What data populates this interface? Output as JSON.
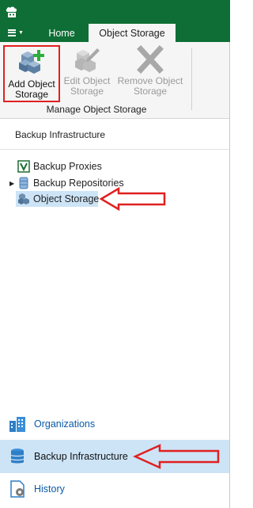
{
  "menu": {
    "home_tab": "Home",
    "active_tab": "Object Storage"
  },
  "ribbon": {
    "add": {
      "line1": "Add Object",
      "line2": "Storage"
    },
    "edit": {
      "line1": "Edit Object",
      "line2": "Storage"
    },
    "remove": {
      "line1": "Remove Object",
      "line2": "Storage"
    },
    "group_label": "Manage Object Storage"
  },
  "nav": {
    "header": "Backup Infrastructure",
    "tree": [
      {
        "label": "Backup Proxies",
        "icon": "proxy-icon"
      },
      {
        "label": "Backup Repositories",
        "icon": "repository-icon"
      },
      {
        "label": "Object Storage",
        "icon": "object-storage-icon",
        "selected": true
      }
    ]
  },
  "bottom_nav": [
    {
      "label": "Organizations",
      "icon": "organizations-icon"
    },
    {
      "label": "Backup Infrastructure",
      "icon": "database-icon",
      "active": true
    },
    {
      "label": "History",
      "icon": "history-icon"
    }
  ],
  "colors": {
    "brand_green": "#0e6e35",
    "selection": "#cde4f7",
    "highlight_red": "#e02020",
    "link_blue": "#0a5aa8"
  }
}
